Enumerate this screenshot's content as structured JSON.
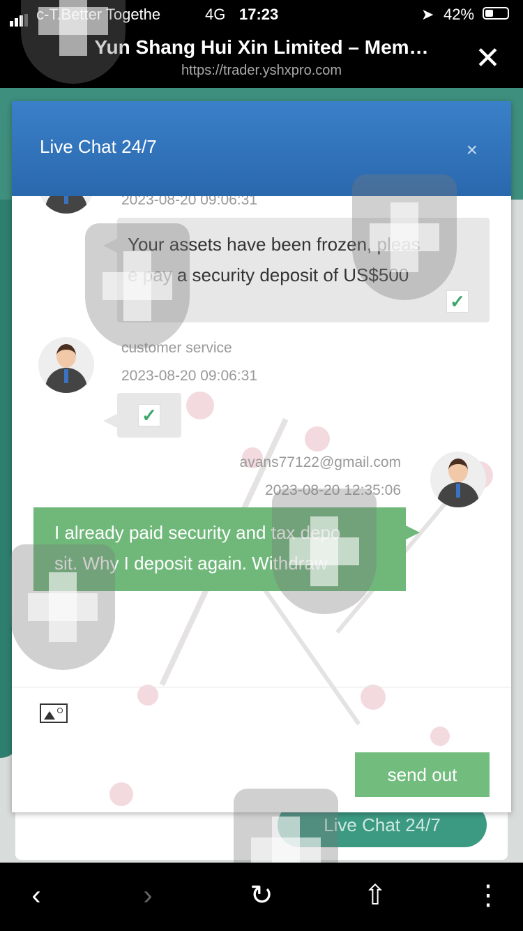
{
  "status_bar": {
    "carrier": "c-T.Better Togethe",
    "network": "4G",
    "time": "17:23",
    "battery_pct": "42%"
  },
  "browser": {
    "title": "Yun Shang Hui Xin Limited – Mem…",
    "url": "https://trader.yshxpro.com",
    "close_glyph": "✕"
  },
  "background_page": {
    "live_chat_button": "Live Chat 24/7",
    "accent_color": "#3c9a83"
  },
  "modal": {
    "title": "Live Chat 24/7",
    "close_glyph": "×",
    "header_color": "#2f72b8"
  },
  "messages": [
    {
      "side": "left",
      "timestamp": "2023-08-20 09:06:31",
      "text_line1": "Your assets have been frozen, pleas",
      "text_line2": "e pay a security deposit of US$500"
    },
    {
      "side": "left",
      "sender": "customer service",
      "timestamp": "2023-08-20 09:06:31",
      "text": ""
    },
    {
      "side": "right",
      "sender": "avans77122@gmail.com",
      "timestamp": "2023-08-20 12:35:06",
      "text_line1": "I already paid security and tax depo",
      "text_line2": "sit. Why I deposit again. Withdraw"
    }
  ],
  "composer": {
    "send_label": "send out",
    "attach_icon": "image-icon"
  },
  "toolbar": {
    "back_glyph": "‹",
    "forward_glyph": "›",
    "reload_glyph": "↻",
    "share_glyph": "⇧",
    "more_glyph": "⋮"
  },
  "icons": {
    "check": "✓",
    "location": "➤"
  }
}
